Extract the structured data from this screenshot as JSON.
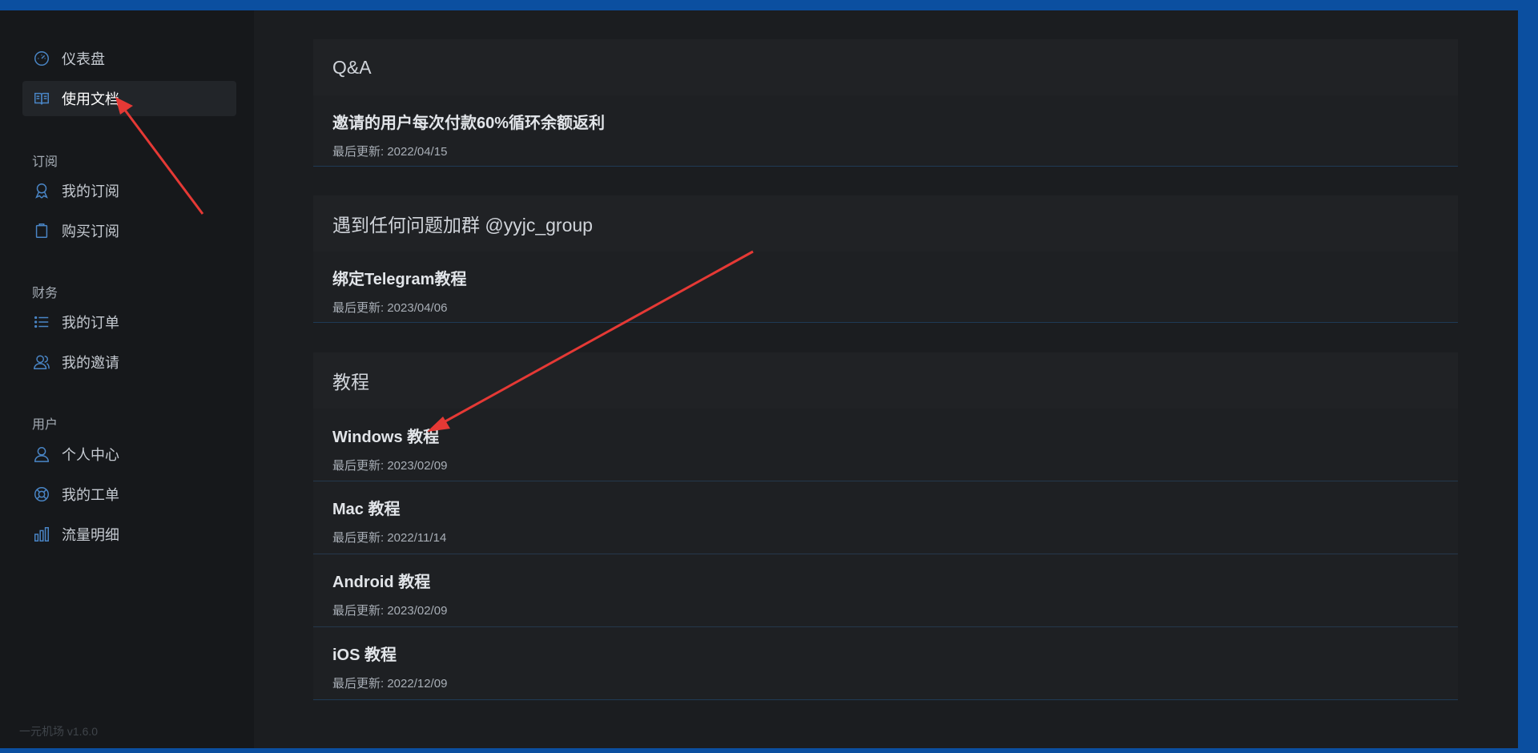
{
  "sidebar": {
    "dashboard": "仪表盘",
    "docs": "使用文档",
    "sections": {
      "subscribe": "订阅",
      "finance": "财务",
      "user": "用户"
    },
    "items": {
      "my_subscription": "我的订阅",
      "buy_subscription": "购买订阅",
      "my_orders": "我的订单",
      "my_invites": "我的邀请",
      "profile": "个人中心",
      "my_tickets": "我的工单",
      "traffic": "流量明细"
    },
    "version": "一元机场 v1.6.0"
  },
  "cards": [
    {
      "title": "Q&A",
      "items": [
        {
          "title": "邀请的用户每次付款60%循环余额返利",
          "date": "最后更新: 2022/04/15"
        }
      ]
    },
    {
      "title": "遇到任何问题加群 @yyjc_group",
      "items": [
        {
          "title": "绑定Telegram教程",
          "date": "最后更新: 2023/04/06"
        }
      ]
    },
    {
      "title": "教程",
      "items": [
        {
          "title": "Windows 教程",
          "date": "最后更新: 2023/02/09"
        },
        {
          "title": "Mac 教程",
          "date": "最后更新: 2022/11/14"
        },
        {
          "title": "Android 教程",
          "date": "最后更新: 2023/02/09"
        },
        {
          "title": "iOS 教程",
          "date": "最后更新: 2022/12/09"
        }
      ]
    }
  ],
  "colors": {
    "accent_icon": "#4a86c7",
    "annotation_arrow": "#e53935",
    "window_frame": "#0b4fa0"
  }
}
